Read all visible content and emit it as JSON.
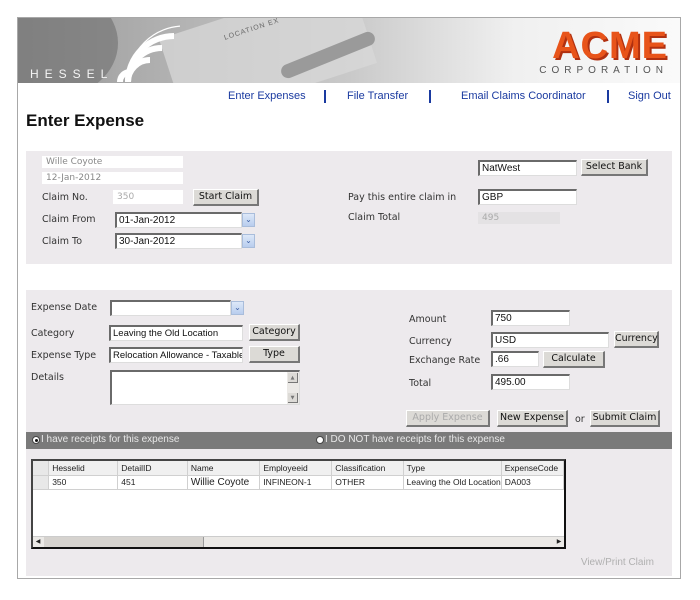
{
  "banner": {
    "left_brand": "HESSEL",
    "right_brand": "ACME",
    "right_brand_sub": "CORPORATION",
    "photo_caption": "LOCATION EX"
  },
  "nav": {
    "items": [
      "Enter Expenses",
      "File Transfer",
      "Email Claims Coordinator",
      "Sign Out"
    ],
    "color": "#1a3aa0"
  },
  "page_title": "Enter Expense",
  "claim": {
    "employee_name": "Wille Coyote",
    "claim_date": "12-Jan-2012",
    "claim_no_label": "Claim No.",
    "claim_no_value": "350",
    "start_claim_button": "Start Claim",
    "claim_from_label": "Claim From",
    "claim_from_value": "01-Jan-2012",
    "claim_to_label": "Claim To",
    "claim_to_value": "30-Jan-2012",
    "bank_value": "NatWest",
    "select_bank_button": "Select Bank",
    "pay_in_label": "Pay this entire claim in",
    "pay_in_value": "GBP",
    "claim_total_label": "Claim Total",
    "claim_total_value": "495"
  },
  "expense": {
    "expense_date_label": "Expense Date",
    "expense_date_value": "",
    "category_label": "Category",
    "category_value": "Leaving the Old Location",
    "category_button": "Category",
    "expense_type_label": "Expense Type",
    "expense_type_value": "Relocation Allowance - Taxable",
    "type_button": "Type",
    "details_label": "Details",
    "details_value": "",
    "amount_label": "Amount",
    "amount_value": "750",
    "currency_label": "Currency",
    "currency_value": "USD",
    "currency_button": "Currency",
    "exchange_rate_label": "Exchange Rate",
    "exchange_rate_value": ".66",
    "calculate_button": "Calculate",
    "total_label": "Total",
    "total_value": "495.00",
    "apply_expense_button": "Apply Expense",
    "new_expense_button": "New Expense",
    "or_text": "or",
    "submit_claim_button": "Submit Claim"
  },
  "receipts": {
    "have_label": "I have receipts for this expense",
    "have_not_label": "I DO NOT have receipts for this expense",
    "selected": "have"
  },
  "grid": {
    "columns": [
      "Hesselid",
      "DetailID",
      "Name",
      "Employeeid",
      "Classification",
      "Type",
      "ExpenseCode"
    ],
    "rows": [
      [
        "350",
        "451",
        "Willie Coyote",
        "INFINEON-1",
        "OTHER",
        "Leaving the Old Location",
        "DA003"
      ]
    ]
  },
  "view_print_link": "View/Print Claim"
}
